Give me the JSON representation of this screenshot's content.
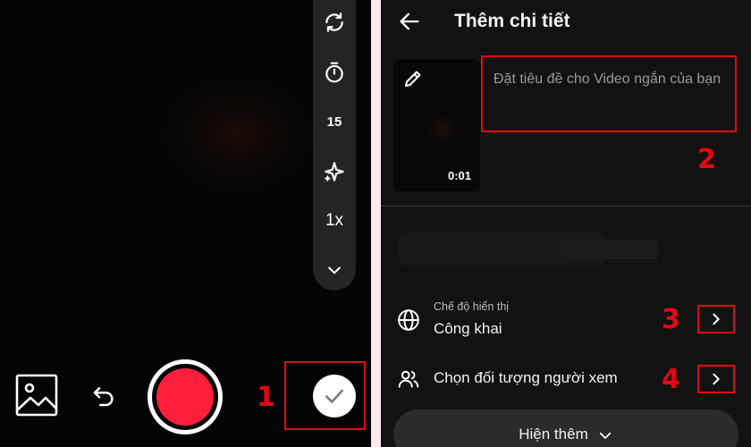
{
  "camera": {
    "side_toolbar": {
      "flip_icon": "camera-flip-icon",
      "timer_icon": "timer-icon",
      "duration_label": "15",
      "effects_icon": "sparkle-icon",
      "speed_label": "1x",
      "more_icon": "chevron-down-icon"
    },
    "bottom": {
      "gallery_icon": "image-icon",
      "undo_icon": "undo-icon",
      "record_color": "#fe1f3d",
      "confirm_icon": "check-icon"
    }
  },
  "details": {
    "back_icon": "arrow-left-icon",
    "title": "Thêm chi tiết",
    "thumbnail": {
      "edit_icon": "pencil-icon",
      "duration": "0:01"
    },
    "caption_placeholder": "Đặt tiêu đề cho Video ngắn của bạn",
    "visibility": {
      "label": "Chế độ hiển thị",
      "value": "Công khai",
      "icon": "globe-icon"
    },
    "audience": {
      "label": "Chọn đối tượng người xem",
      "icon": "people-icon"
    },
    "show_more_label": "Hiện thêm"
  },
  "annotations": {
    "color": "#e10a14",
    "markers": [
      "1",
      "2",
      "3",
      "4"
    ]
  }
}
